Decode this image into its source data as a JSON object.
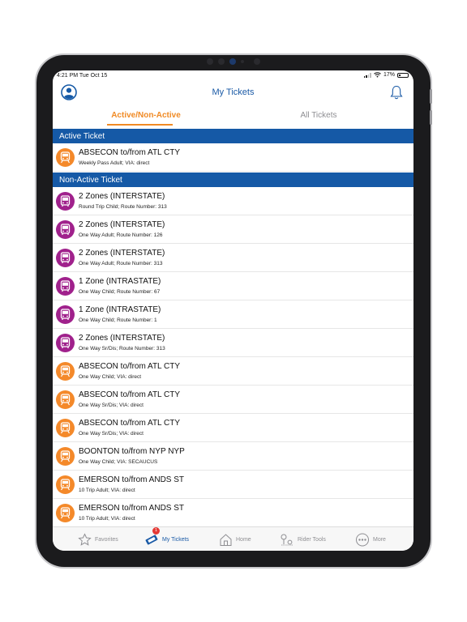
{
  "status": {
    "time": "4:21 PM  Tue Oct 15",
    "battery": "17%"
  },
  "header": {
    "title": "My Tickets"
  },
  "tabs": [
    {
      "label": "Active/Non-Active"
    },
    {
      "label": "All Tickets"
    }
  ],
  "sections": {
    "active": "Active Ticket",
    "non_active": "Non-Active Ticket"
  },
  "colors": {
    "brand_blue": "#1559a6",
    "accent_orange": "#f08a24",
    "bus_purple": "#a0218c",
    "train_orange": "#f4892a"
  },
  "active_tickets": [
    {
      "title": "ABSECON to/from ATL CTY",
      "sub": "Weekly Pass Adult; VIA: direct",
      "mode": "train"
    }
  ],
  "non_active_tickets": [
    {
      "title": "2 Zones (INTERSTATE)",
      "sub": " Round Trip Child; Route Number: 313",
      "mode": "bus"
    },
    {
      "title": "2 Zones (INTERSTATE)",
      "sub": "One Way Adult; Route Number: 126",
      "mode": "bus"
    },
    {
      "title": "2 Zones (INTERSTATE)",
      "sub": "One Way Adult; Route Number: 313",
      "mode": "bus"
    },
    {
      "title": "1 Zone (INTRASTATE)",
      "sub": "One Way Child; Route Number: 67",
      "mode": "bus"
    },
    {
      "title": "1 Zone (INTRASTATE)",
      "sub": "One Way Child; Route Number: 1",
      "mode": "bus"
    },
    {
      "title": "2 Zones (INTERSTATE)",
      "sub": "One Way Sr/Dis; Route Number: 313",
      "mode": "bus"
    },
    {
      "title": "ABSECON to/from ATL CTY",
      "sub": "One Way Child; VIA: direct",
      "mode": "train"
    },
    {
      "title": "ABSECON to/from ATL CTY",
      "sub": "One Way Sr/Dis; VIA: direct",
      "mode": "train"
    },
    {
      "title": "ABSECON to/from ATL CTY",
      "sub": "One Way Sr/Dis; VIA: direct",
      "mode": "train"
    },
    {
      "title": "BOONTON to/from NYP NYP",
      "sub": "One Way Child; VIA: SECAUCUS",
      "mode": "train"
    },
    {
      "title": "EMERSON to/from ANDS ST",
      "sub": "10 Trip Adult; VIA: direct",
      "mode": "train"
    },
    {
      "title": "EMERSON to/from ANDS ST",
      "sub": "10 Trip Adult; VIA: direct",
      "mode": "train"
    }
  ],
  "tabbar": [
    {
      "label": "Favorites",
      "icon": "star-icon"
    },
    {
      "label": "My Tickets",
      "icon": "ticket-icon",
      "badge": "1"
    },
    {
      "label": "Home",
      "icon": "home-icon"
    },
    {
      "label": "Rider Tools",
      "icon": "map-pin-icon"
    },
    {
      "label": "More",
      "icon": "more-icon"
    }
  ]
}
